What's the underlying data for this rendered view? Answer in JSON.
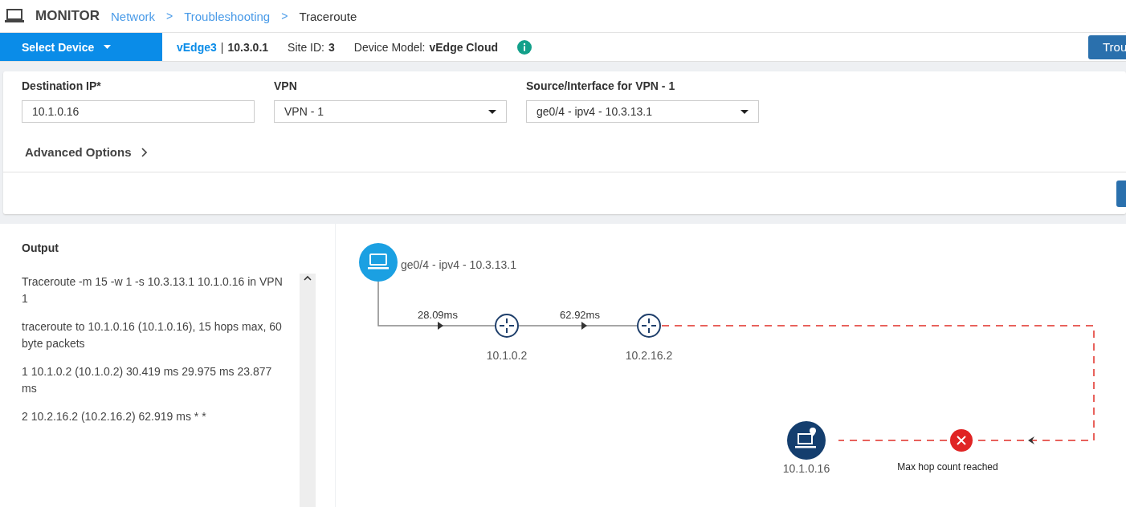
{
  "header": {
    "title": "MONITOR",
    "separator": ">",
    "breadcrumb": [
      {
        "label": "Network",
        "link": true
      },
      {
        "label": "Troubleshooting",
        "link": true
      },
      {
        "label": "Traceroute",
        "link": false
      }
    ]
  },
  "device_bar": {
    "select_label": "Select Device",
    "device_name": "vEdge3",
    "divider": "|",
    "device_ip": "10.3.0.1",
    "site_label": "Site ID:",
    "site_id": "3",
    "model_label": "Device Model:",
    "model": "vEdge Cloud",
    "action_button": "Trou"
  },
  "form": {
    "fields": [
      {
        "label": "Destination IP*",
        "kind": "text",
        "value": "10.1.0.16"
      },
      {
        "label": "VPN",
        "kind": "select",
        "value": "VPN - 1"
      },
      {
        "label": "Source/Interface for VPN - 1",
        "kind": "select",
        "value": "ge0/4 - ipv4 - 10.3.13.1"
      }
    ],
    "advanced_options": "Advanced Options"
  },
  "output": {
    "title": "Output",
    "lines": [
      "Traceroute -m 15 -w 1 -s 10.3.13.1 10.1.0.16 in VPN 1",
      "traceroute to 10.1.0.16 (10.1.0.16), 15 hops max, 60 byte packets",
      "1 10.1.0.2 (10.1.0.2) 30.419 ms 29.975 ms 23.877 ms",
      "2 10.2.16.2 (10.2.16.2) 62.919 ms * *"
    ]
  },
  "diagram": {
    "source": "ge0/4 - ipv4 - 10.3.13.1",
    "hops": [
      {
        "ip": "10.1.0.2",
        "latency": "28.09ms"
      },
      {
        "ip": "10.2.16.2",
        "latency": "62.92ms"
      }
    ],
    "destination": "10.1.0.16",
    "error": "Max hop count reached"
  }
}
